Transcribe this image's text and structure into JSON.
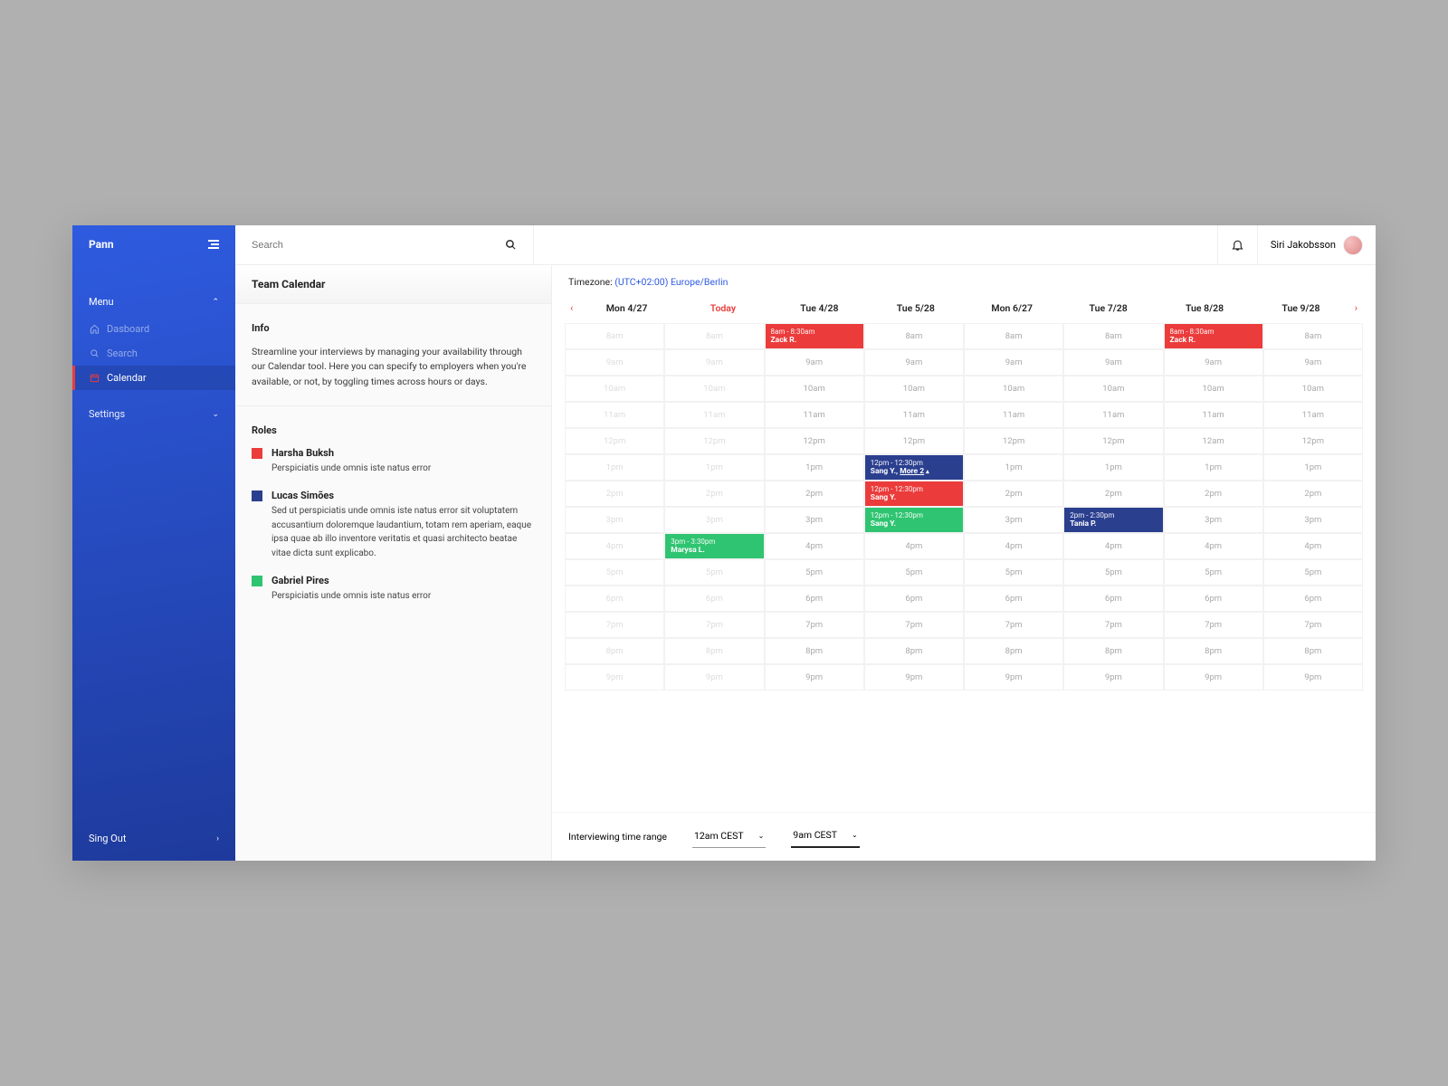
{
  "brand": "Pann",
  "sidebar": {
    "menu_label": "Menu",
    "items": [
      {
        "icon": "home",
        "label": "Dasboard"
      },
      {
        "icon": "search",
        "label": "Search"
      },
      {
        "icon": "calendar",
        "label": "Calendar"
      }
    ],
    "settings": "Settings",
    "signout": "Sing Out"
  },
  "topbar": {
    "search_placeholder": "Search",
    "username": "Siri Jakobsson"
  },
  "page": {
    "title": "Team Calendar",
    "info_heading": "Info",
    "info_text": "Streamline your interviews by managing your availability through our Calendar tool. Here you can specify to employers when you're available, or not, by toggling times across hours or days.",
    "roles_heading": "Roles",
    "roles": [
      {
        "color": "#eb3b3b",
        "name": "Harsha Buksh",
        "desc": "Perspiciatis unde omnis iste natus error"
      },
      {
        "color": "#2b3f8f",
        "name": "Lucas Simões",
        "desc": "Sed ut perspiciatis unde omnis iste natus error sit voluptatem accusantium doloremque laudantium, totam rem aperiam, eaque ipsa quae ab illo inventore veritatis et quasi architecto beatae vitae dicta sunt explicabo."
      },
      {
        "color": "#2fc471",
        "name": "Gabriel Pires",
        "desc": "Perspiciatis unde omnis iste natus error"
      }
    ]
  },
  "calendar": {
    "timezone_label": "Timezone:",
    "timezone_value": "(UTC+02:00) Europe/Berlin",
    "days": [
      "Mon 4/27",
      "Today",
      "Tue 4/28",
      "Tue 5/28",
      "Mon 6/27",
      "Tue 7/28",
      "Tue 8/28",
      "Tue 9/28"
    ],
    "today_index": 1,
    "hours": [
      "8am",
      "9am",
      "10am",
      "11am",
      "12pm",
      "1pm",
      "2pm",
      "3pm",
      "4pm",
      "5pm",
      "6pm",
      "7pm",
      "8pm",
      "9pm"
    ],
    "faded_cols": [
      0,
      1
    ],
    "grid_labels": {
      "6_4": "12am"
    },
    "events": [
      {
        "col": 2,
        "row": 0,
        "color": "red",
        "time": "8am - 8:30am",
        "person": "Zack R."
      },
      {
        "col": 6,
        "row": 0,
        "color": "red",
        "time": "8am - 8:30am",
        "person": "Zack R."
      },
      {
        "col": 3,
        "row": 5,
        "color": "blue",
        "time": "12pm - 12:30pm",
        "person": "Sang Y.",
        "more": "More 2"
      },
      {
        "col": 3,
        "row": 6,
        "color": "red",
        "time": "12pm - 12:30pm",
        "person": "Sang Y."
      },
      {
        "col": 3,
        "row": 7,
        "color": "green",
        "time": "12pm - 12:30pm",
        "person": "Sang Y."
      },
      {
        "col": 1,
        "row": 8,
        "color": "green",
        "time": "3pm - 3:30pm",
        "person": "Marysa L."
      },
      {
        "col": 5,
        "row": 7,
        "color": "blue",
        "time": "2pm - 2:30pm",
        "person": "Tania P."
      }
    ],
    "footer": {
      "label": "Interviewing time range",
      "from": "12am CEST",
      "to": "9am CEST"
    }
  }
}
